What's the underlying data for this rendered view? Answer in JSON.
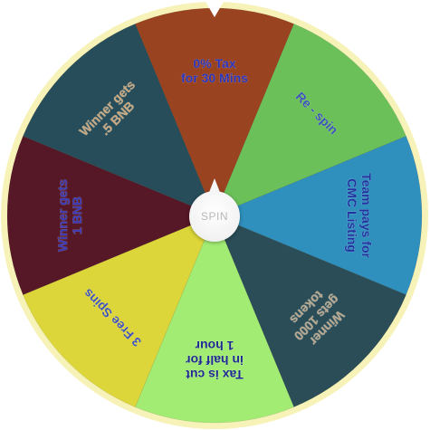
{
  "wheel": {
    "rim_color": "#f7f2b8",
    "pointer_color": "#ffffff",
    "slices": [
      {
        "lines": [
          "0% Tax",
          "for 30 Mins"
        ],
        "color": "#9a4320",
        "text_color": "#2b33b8"
      },
      {
        "lines": [
          "Re - spin"
        ],
        "color": "#6cc05a",
        "text_color": "#3c55b8"
      },
      {
        "lines": [
          "Team pays for",
          "CMC Listing"
        ],
        "color": "#2f8fbd",
        "text_color": "#2233a0"
      },
      {
        "lines": [
          "Winner",
          "gets 1000",
          "tokens"
        ],
        "color": "#2a4d57",
        "text_color": "#b8a890"
      },
      {
        "lines": [
          "Tax is cut",
          "in half for",
          "1 hour"
        ],
        "color": "#a3ec74",
        "text_color": "#1e2a90"
      },
      {
        "lines": [
          "3 Free Spins"
        ],
        "color": "#dcd63a",
        "text_color": "#4455b8"
      },
      {
        "lines": [
          "Winner gets",
          "1 BNB"
        ],
        "color": "#561726",
        "text_color": "#3a3ab8"
      },
      {
        "lines": [
          "Winner gets",
          ".5 BNB"
        ],
        "color": "#264d59",
        "text_color": "#c8a880"
      }
    ]
  },
  "spin_button": {
    "label": "SPIN"
  }
}
